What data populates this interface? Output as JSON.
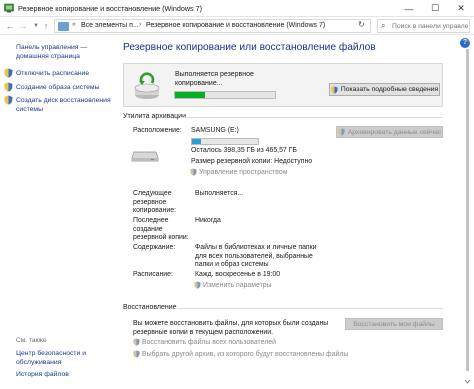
{
  "window": {
    "title": "Резервное копирование и восстановление (Windows 7)",
    "minimize_glyph": "—",
    "maximize_glyph": "☐",
    "close_glyph": "✕"
  },
  "address": {
    "crumb_sep": "«",
    "crumb1": "Все элементы п...",
    "crumb_arrow": "›",
    "crumb2": "Резервное копирование и восстановление (Windows 7)",
    "search_placeholder": "Поиск в панели управления"
  },
  "help_glyph": "?",
  "sidebar": {
    "home_link": "Панель управления —\nдомашняя страница",
    "items": [
      {
        "label": "Отключить расписание"
      },
      {
        "label": "Создание образа системы"
      },
      {
        "label": "Создать диск восстановления\nсистемы"
      }
    ],
    "see_also": "См. также",
    "see_also_items": [
      {
        "label": "Центр безопасности и\nобслуживания"
      },
      {
        "label": "История файлов"
      }
    ]
  },
  "main": {
    "title": "Резервное копирование или восстановление файлов",
    "progress": {
      "status": "Выполняется резервное копирование...",
      "percent": 30,
      "details_button": "Показать подробные сведения"
    },
    "archive": {
      "header": "Утилита архивации",
      "location_label": "Расположение:",
      "drive_name": "SAMSUNG (E:)",
      "drive_used_fraction": 0.14,
      "free_space": "Осталось 398,35 ГБ из 465,57 ГБ",
      "backup_size": "Размер резервной копии: Недоступно",
      "manage_space": "Управление пространством",
      "backup_now_button": "Архивировать данные сейчас",
      "next_label": "Следующее резервное копирование:",
      "next_value": "Выполняется...",
      "last_label": "Последнее создание резервной копии:",
      "last_value": "Никогда",
      "content_label": "Содержание:",
      "content_value": "Файлы в библиотеках и личные папки для всех пользователей, выбранные папки и образ системы",
      "schedule_label": "Расписание:",
      "schedule_value": "Кажд. воскресенье в 19:00",
      "change_settings": "Изменить параметры"
    },
    "restore": {
      "header": "Восстановление",
      "description": "Вы можете восстановить файлы, для которых были созданы резервные копии в текущем расположении.",
      "restore_button": "Восстановить мои файлы",
      "restore_all_users": "Восстановить файлы всех пользователей",
      "choose_other": "Выбрать другой архив, из которого будут восстановлены файлы"
    }
  },
  "colors": {
    "link": "#1a3a8a",
    "title": "#1e3287",
    "progress_green": "#06b025",
    "drive_blue": "#26a0da",
    "help_blue": "#1f6fcf"
  },
  "icons": [
    "control-panel-icon",
    "back-arrow-icon",
    "forward-arrow-icon",
    "up-arrow-icon",
    "refresh-icon",
    "search-icon",
    "shield-icon",
    "backup-icon",
    "drive-icon",
    "help-icon"
  ]
}
